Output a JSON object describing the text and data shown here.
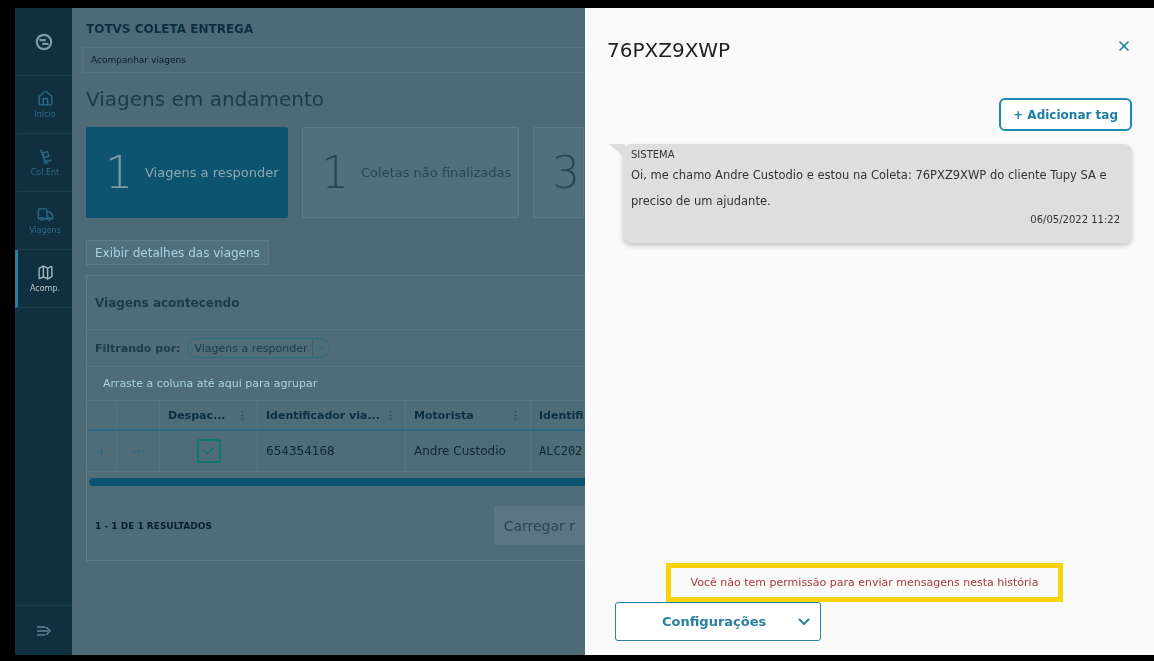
{
  "app_title": "TOTVS COLETA ENTREGA",
  "breadcrumb": "Acompanhar viagens",
  "page_title": "Viagens em andamento",
  "sidebar": {
    "items": [
      {
        "kind": "home",
        "label": "Início",
        "selected": false
      },
      {
        "kind": "dolly",
        "label": "Col.Ent",
        "selected": false
      },
      {
        "kind": "truck",
        "label": "Viagens",
        "selected": false
      },
      {
        "kind": "map",
        "label": "Acomp.",
        "selected": true
      }
    ]
  },
  "summary_cards": [
    {
      "count": "1",
      "label": "Viagens a responder",
      "selected": true
    },
    {
      "count": "1",
      "label": "Coletas não finalizadas",
      "selected": false
    },
    {
      "count": "3",
      "selected": false
    }
  ],
  "details_button": "Exibir detalhes das viagens",
  "panel": {
    "title": "Viagens acontecendo",
    "filter_label": "Filtrando por:",
    "filter_chip": "Viagens a responder",
    "group_hint": "Arraste a coluna até aqui para agrupar",
    "table": {
      "columns": [
        "Despac...",
        "Identificador via...",
        "Motorista",
        "Identifi"
      ],
      "rows": [
        {
          "cells": [
            {
              "kind": "checkbox",
              "checked": true
            },
            {
              "kind": "text",
              "text": "654354168"
            },
            {
              "kind": "text",
              "text": "Andre Custodio"
            },
            {
              "kind": "mono",
              "text": "ALC202"
            }
          ]
        }
      ]
    },
    "results": "1 - 1 DE 1 RESULTADOS",
    "load_button": "Carregar r"
  },
  "drawer": {
    "title": "76PXZ9XWP",
    "add_tag_button": "+ Adicionar tag",
    "messages": [
      {
        "sender": "SISTEMA",
        "text": "Oi, me chamo Andre Custodio e estou na Coleta: 76PXZ9XWP do cliente Tupy SA e preciso de um ajudante.",
        "time": "06/05/2022 11:22"
      }
    ],
    "notice": "Você não tem permissão para enviar mensagens nesta história",
    "config_button": "Configurações"
  }
}
